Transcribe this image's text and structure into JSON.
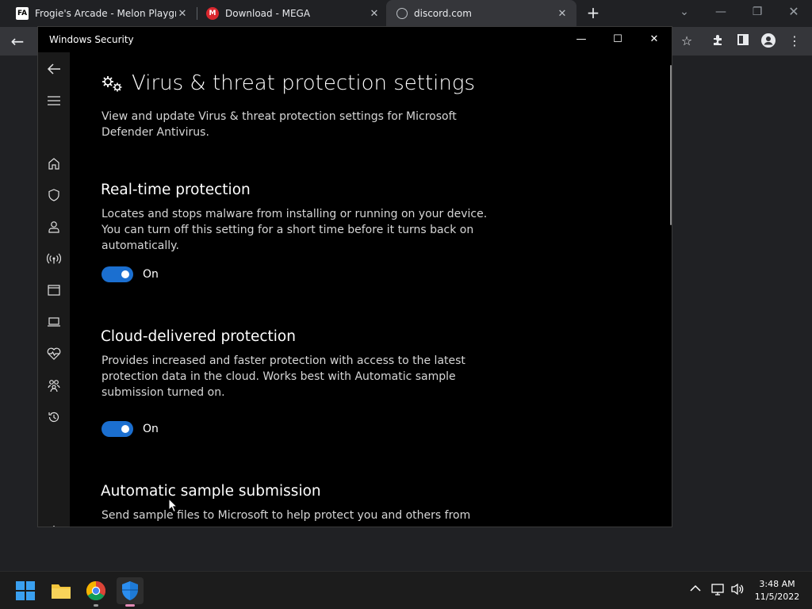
{
  "browser": {
    "tabs": [
      {
        "title": "Frogie's Arcade - Melon Playgrou",
        "favicon_text": "FA",
        "favicon_color": "#1a73e8"
      },
      {
        "title": "Download - MEGA",
        "favicon_text": "M",
        "favicon_color": "#d9272e"
      },
      {
        "title": "discord.com",
        "favicon_text": "",
        "favicon_color": "#9aa0a6"
      }
    ],
    "new_tab_label": "+"
  },
  "window": {
    "title": "Windows Security",
    "minimize_label": "—",
    "maximize_label": "☐",
    "close_label": "✕"
  },
  "page": {
    "title": "Virus & threat protection settings",
    "description": "View and update Virus & threat protection settings for Microsoft Defender Antivirus."
  },
  "sections": [
    {
      "heading": "Real-time protection",
      "description": "Locates and stops malware from installing or running on your device. You can turn off this setting for a short time before it turns back on automatically.",
      "toggle_label": "On",
      "enabled": true
    },
    {
      "heading": "Cloud-delivered protection",
      "description": "Provides increased and faster protection with access to the latest protection data in the cloud. Works best with Automatic sample submission turned on.",
      "toggle_label": "On",
      "enabled": true
    },
    {
      "heading": "Automatic sample submission",
      "description": "Send sample files to Microsoft to help protect you and others from"
    }
  ],
  "nav_icons": [
    "back-icon",
    "menu-icon",
    "home-icon",
    "shield-icon",
    "account-icon",
    "firewall-network-icon",
    "app-browser-control-icon",
    "device-security-icon",
    "device-health-icon",
    "family-options-icon",
    "protection-history-icon",
    "settings-icon"
  ],
  "taskbar": {
    "time": "3:48 AM",
    "date": "11/5/2022"
  },
  "colors": {
    "accent": "#1b6fd0",
    "window_bg": "#000000",
    "nav_bg": "#1a1a1a"
  }
}
